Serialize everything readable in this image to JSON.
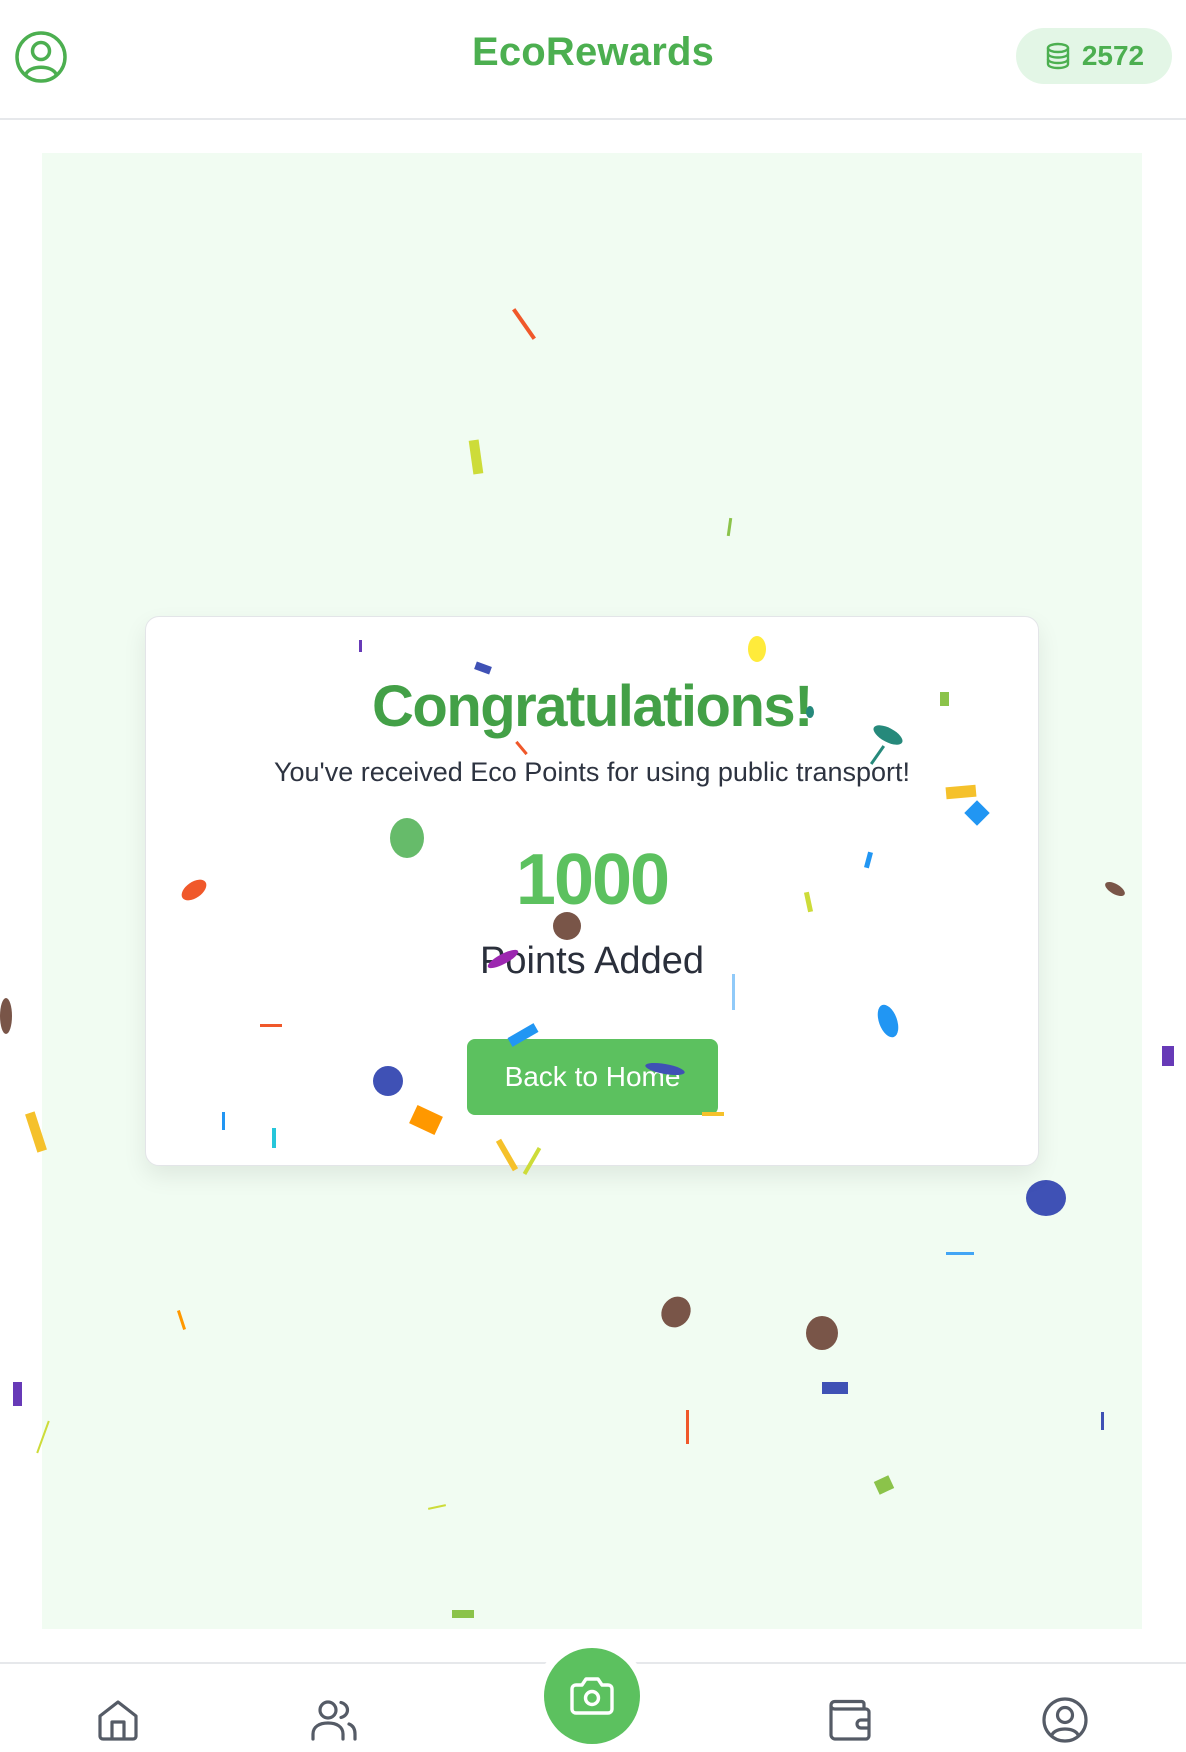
{
  "header": {
    "title": "EcoRewards",
    "points_balance": "2572",
    "profile_icon": "user-circle-icon",
    "coins_icon": "coins-stack-icon"
  },
  "celebration": {
    "heading": "Congratulations!",
    "message": "You've received Eco Points for using public transport!",
    "points_amount": "1000",
    "points_label": "Points Added",
    "button_label": "Back to Home"
  },
  "bottom_nav": {
    "items": [
      {
        "id": "home",
        "icon": "home-icon"
      },
      {
        "id": "community",
        "icon": "users-icon"
      },
      {
        "id": "scan",
        "icon": "camera-icon"
      },
      {
        "id": "wallet",
        "icon": "wallet-icon"
      },
      {
        "id": "profile",
        "icon": "user-circle-icon"
      }
    ]
  },
  "colors": {
    "brand_green": "#4caf50",
    "button_green": "#5cc15f",
    "stage_background": "#f1fcf2",
    "pill_background": "#e3f6e6"
  }
}
